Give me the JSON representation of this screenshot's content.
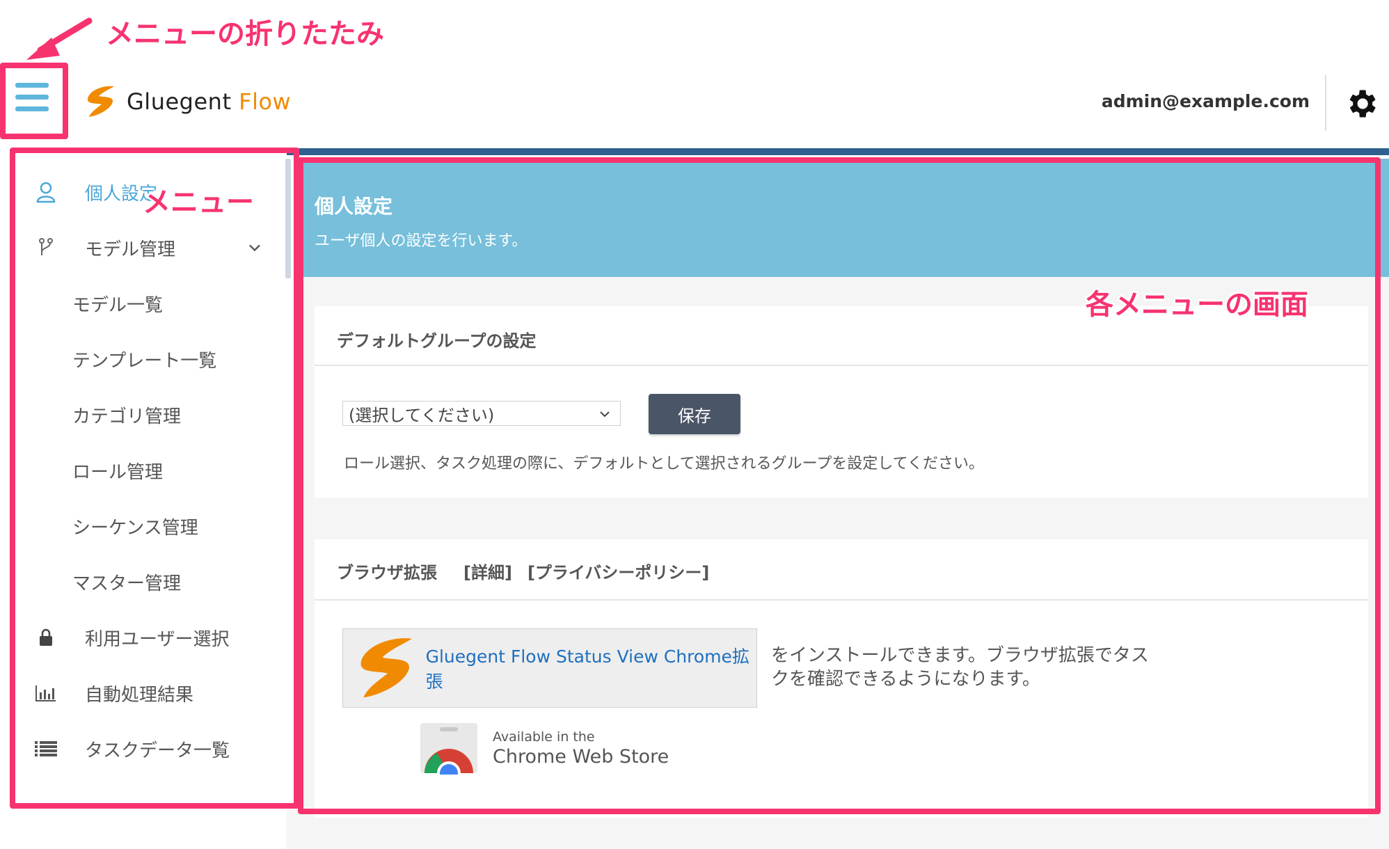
{
  "annotations": {
    "menu_collapse": "メニューの折りたたみ",
    "menu": "メニュー",
    "screen": "各メニューの画面",
    "color": "#f7336f"
  },
  "header": {
    "logo_name": "Gluegent",
    "logo_product": "Flow",
    "user_email": "admin@example.com",
    "icons": [
      "hamburger-icon",
      "logo-icon",
      "gear-icon"
    ]
  },
  "sidebar": {
    "items": [
      {
        "label": "個人設定",
        "icon": "user-icon",
        "active": true
      },
      {
        "label": "モデル管理",
        "icon": "fork-icon",
        "expandable": true
      },
      {
        "label": "モデル一覧"
      },
      {
        "label": "テンプレート一覧"
      },
      {
        "label": "カテゴリ管理"
      },
      {
        "label": "ロール管理"
      },
      {
        "label": "シーケンス管理"
      },
      {
        "label": "マスター管理"
      },
      {
        "label": "利用ユーザー選択",
        "icon": "lock-icon"
      },
      {
        "label": "自動処理結果",
        "icon": "bar-chart-icon"
      },
      {
        "label": "タスクデータ一覧",
        "icon": "list-icon"
      }
    ]
  },
  "main": {
    "title": "個人設定",
    "subtitle": "ユーザ個人の設定を行います。",
    "default_group": {
      "title": "デフォルトグループの設定",
      "select_value": "(選択してください)",
      "save_label": "保存",
      "note": "ロール選択、タスク処理の際に、デフォルトとして選択されるグループを設定してください。"
    },
    "browser_ext": {
      "title": "ブラウザ拡張",
      "details_link": "[詳細]",
      "privacy_link": "[プライバシーポリシー]",
      "ext_link": "Gluegent Flow Status View Chrome拡張",
      "description": "をインストールできます。ブラウザ拡張でタスクを確認できるようになります。",
      "store_small": "Available in the",
      "store_big": "Chrome Web Store"
    }
  },
  "colors": {
    "accent": "#4aa7d8",
    "banner": "#77bfdb",
    "brand_orange": "#f08a00",
    "save_button": "#4a5568",
    "header_strip": "#2f5f8f"
  }
}
